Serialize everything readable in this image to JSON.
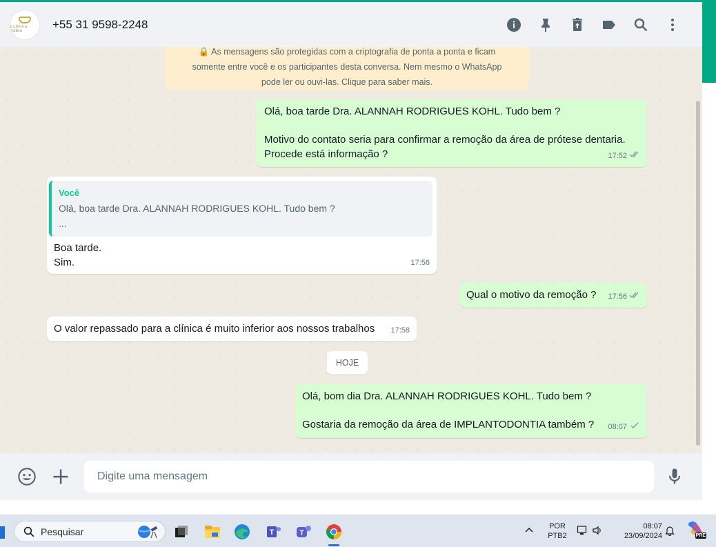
{
  "header": {
    "contact_name": "+55 31 9598-2248",
    "avatar_text": "CLÍNICA SABIÁ",
    "icons": [
      "info-icon",
      "pin-icon",
      "delete-icon",
      "label-icon",
      "search-icon",
      "menu-icon"
    ]
  },
  "chat": {
    "encryption_notice": {
      "line1": "🔒 As mensagens são protegidas com a criptografia de ponta a ponta e ficam",
      "line2": "somente entre você e os participantes desta conversa. Nem mesmo o WhatsApp",
      "line3": "pode ler ou ouvi-las. Clique para saber mais."
    },
    "messages": [
      {
        "direction": "out",
        "line1": "Olá, boa tarde Dra. ALANNAH RODRIGUES KOHL. Tudo bem ?",
        "line2": "Motivo do contato seria para confirmar a remoção da área de prótese dentaria.",
        "line3": "Procede está informação ?",
        "time": "17:52"
      },
      {
        "direction": "in",
        "quote_author": "Você",
        "quote_text": "Olá, boa tarde Dra. ALANNAH RODRIGUES KOHL. Tudo bem ?",
        "quote_more": "...",
        "line1": "Boa tarde.",
        "line2": "Sim.",
        "time": "17:56"
      },
      {
        "direction": "out",
        "text": "Qual o motivo da remoção ?",
        "time": "17:56"
      },
      {
        "direction": "in",
        "text": "O valor repassado para a clínica  é muito inferior aos nossos trabalhos",
        "time": "17:58"
      },
      {
        "direction": "out",
        "line1": "Olá, bom dia Dra. ALANNAH RODRIGUES KOHL. Tudo bem ?",
        "line2": "Gostaria da remoção da área de  IMPLANTODONTIA também ?",
        "time": "08:07"
      }
    ],
    "day_separator": "HOJE"
  },
  "composer": {
    "placeholder": "Digite uma mensagem"
  },
  "taskbar": {
    "search_label": "Pesquisar",
    "lang_line1": "POR",
    "lang_line2": "PTB2",
    "clock_time": "08:07",
    "clock_date": "23/09/2024",
    "pre_badge": "PRE"
  },
  "colors": {
    "accent": "#00a884",
    "outgoing_bubble": "#d9fdd3",
    "chat_background": "#efeae2",
    "read_ticks": "#53bdeb"
  }
}
